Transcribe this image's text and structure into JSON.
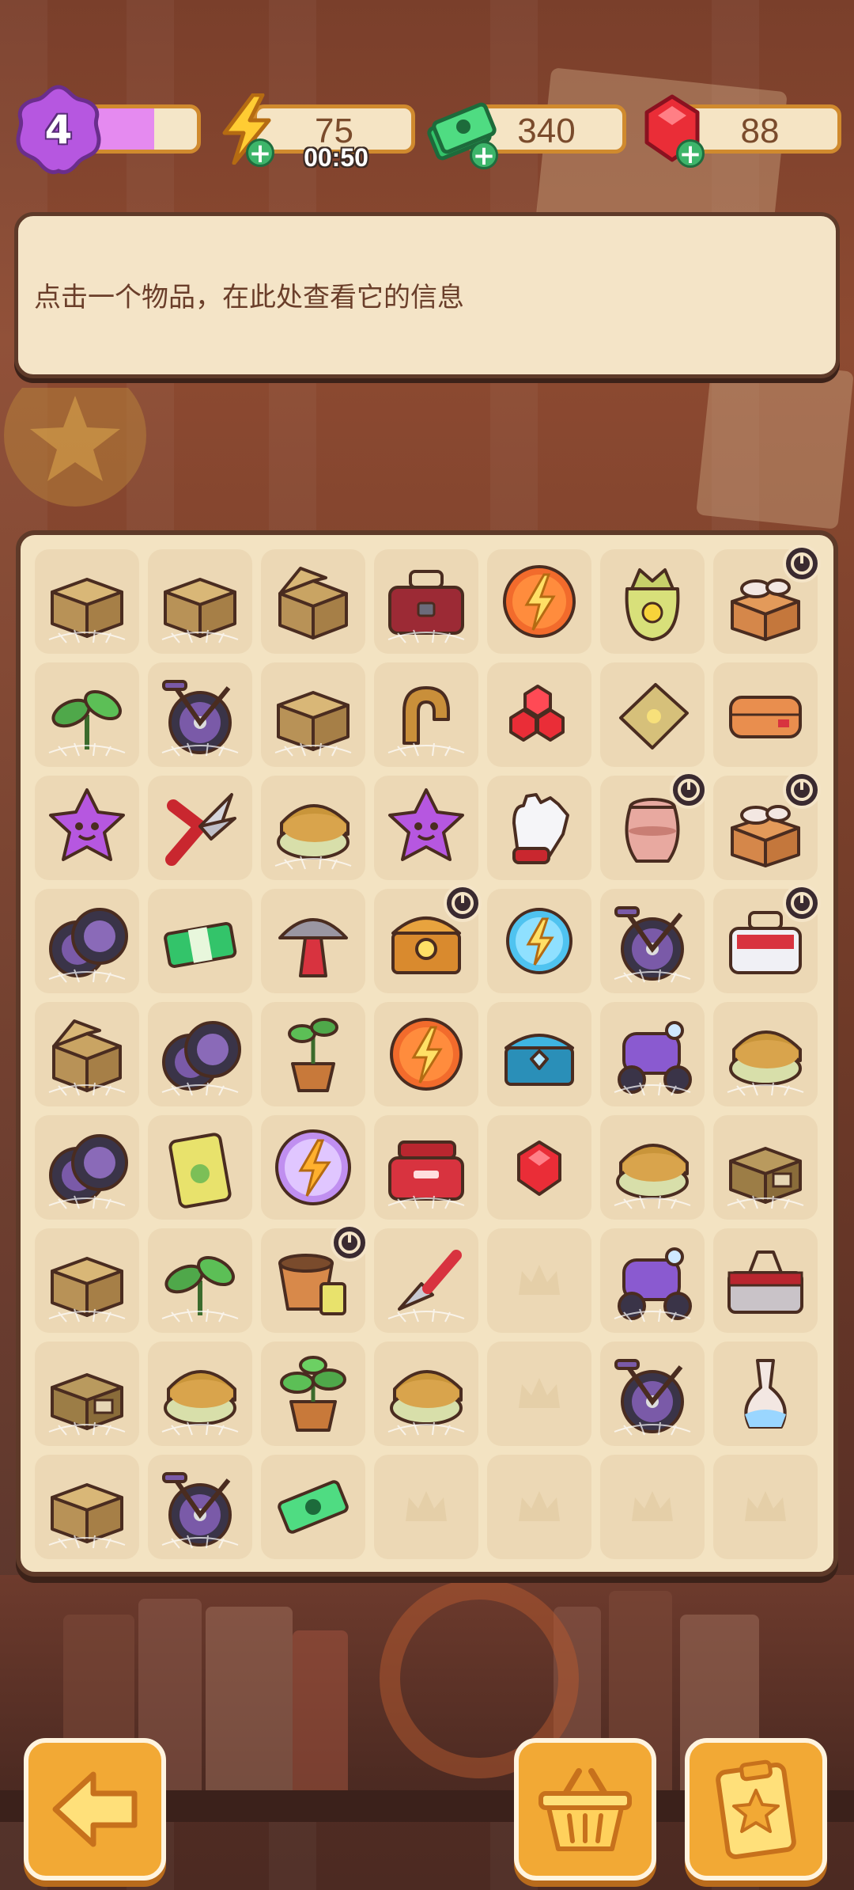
{
  "header": {
    "level": "4",
    "xp_fraction": 0.6,
    "energy": {
      "value": "75",
      "timer": "00:50"
    },
    "cash": {
      "value": "340"
    },
    "gems": {
      "value": "88"
    }
  },
  "info_panel": {
    "text": "点击一个物品，在此处查看它的信息"
  },
  "colors": {
    "accent": "#f2a935",
    "board_bg": "#f3e3c2",
    "frame": "#5e3a29",
    "xp_fill": "#e58af0"
  },
  "board": {
    "columns": 7,
    "rows": [
      [
        "box",
        "box",
        "box-open",
        "toolbox-red",
        "energy-orb",
        "seed-bag",
        "cardboard-box-dishes"
      ],
      [
        "sprout",
        "bicycle",
        "box",
        "horseshoe",
        "ruby-pile",
        "seed-packet-flat",
        "envelope-folded"
      ],
      [
        "purple-star-smiley",
        "pruning-shears",
        "wheel-of-cheese",
        "purple-star-smiley",
        "gardening-glove",
        "clay-pot",
        "cardboard-box-dishes"
      ],
      [
        "tire-stack",
        "cash-bundle",
        "mushroom-lamp",
        "treasure-chest",
        "energy-orb-blue",
        "bicycle",
        "toolbox-white"
      ],
      [
        "box-open",
        "tire-stack",
        "potted-plant",
        "energy-orb",
        "chest-blue",
        "scooter",
        "wheel-of-cheese"
      ],
      [
        "tire-stack",
        "seed-packet",
        "energy-orb-purple",
        "toolbox-red-open",
        "ruby",
        "wheel-of-cheese",
        "crate"
      ],
      [
        "box",
        "sprout",
        "flower-pot-seeds",
        "trowel",
        "empty",
        "scooter",
        "toolbox-grey"
      ],
      [
        "crate",
        "wheel-of-cheese",
        "potted-plant-large",
        "wheel-of-cheese",
        "empty",
        "bicycle",
        "vase"
      ],
      [
        "box",
        "bicycle",
        "cash-single",
        "empty",
        "empty",
        "empty",
        "empty"
      ]
    ],
    "locked_cells": [
      [
        0,
        6
      ],
      [
        2,
        5
      ],
      [
        2,
        6
      ],
      [
        3,
        3
      ],
      [
        3,
        6
      ],
      [
        6,
        2
      ]
    ],
    "cobweb_cells": [
      [
        0,
        0
      ],
      [
        0,
        1
      ],
      [
        0,
        3
      ],
      [
        1,
        0
      ],
      [
        1,
        1
      ],
      [
        1,
        2
      ],
      [
        1,
        3
      ],
      [
        2,
        2
      ],
      [
        3,
        0
      ],
      [
        3,
        5
      ],
      [
        4,
        0
      ],
      [
        4,
        1
      ],
      [
        4,
        5
      ],
      [
        4,
        6
      ],
      [
        5,
        0
      ],
      [
        5,
        3
      ],
      [
        5,
        5
      ],
      [
        5,
        6
      ],
      [
        6,
        0
      ],
      [
        6,
        1
      ],
      [
        6,
        3
      ],
      [
        6,
        5
      ],
      [
        7,
        0
      ],
      [
        7,
        1
      ],
      [
        7,
        3
      ],
      [
        7,
        5
      ],
      [
        8,
        0
      ],
      [
        8,
        1
      ]
    ]
  },
  "bottom_bar": {
    "back_icon": "arrow-left-icon",
    "basket_icon": "basket-icon",
    "orders_icon": "clipboard-star-icon"
  }
}
